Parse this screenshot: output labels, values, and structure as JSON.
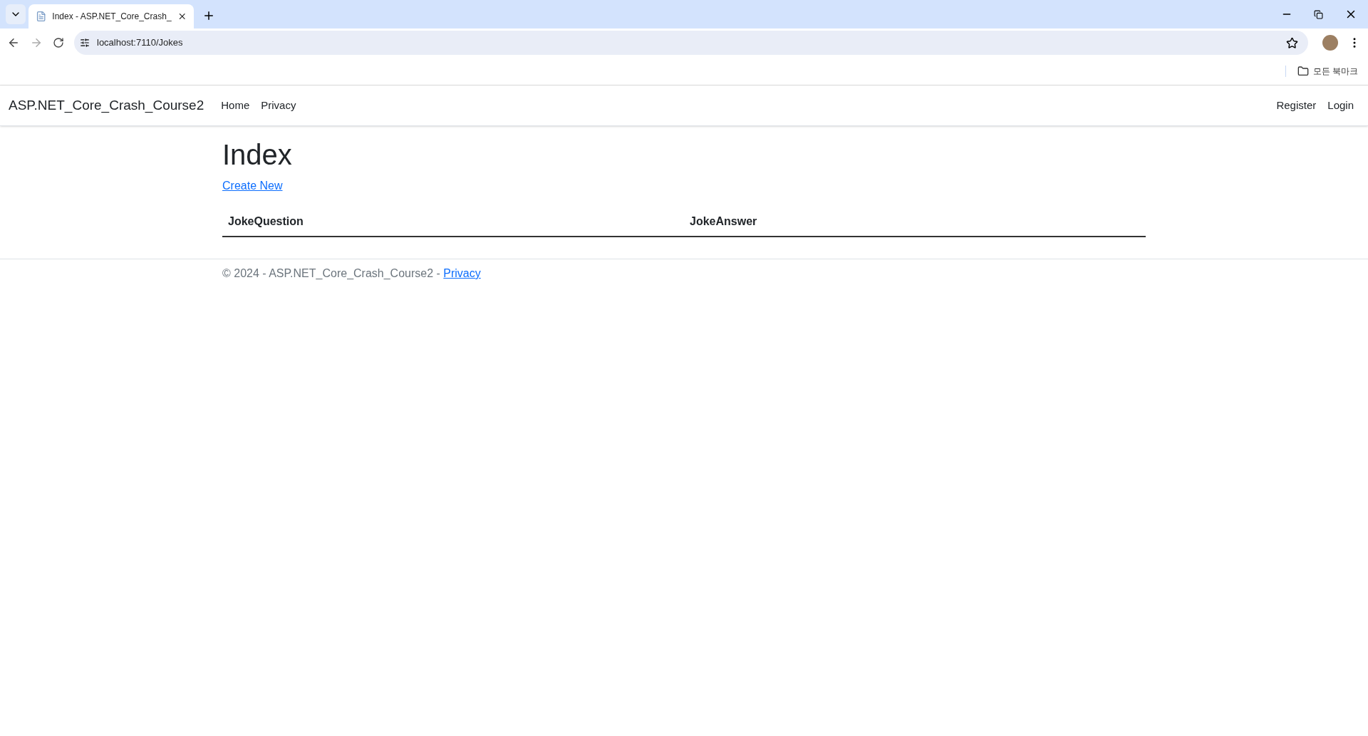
{
  "browser": {
    "tabs": [
      {
        "title": "Index - ASP.NET_Core_Crash_",
        "selected": true
      }
    ],
    "address": "localhost:7110/Jokes",
    "bookmarks_label": "모든 북마크"
  },
  "navbar": {
    "brand": "ASP.NET_Core_Crash_Course2",
    "links": [
      "Home",
      "Privacy"
    ],
    "account_links": [
      "Register",
      "Login"
    ]
  },
  "page": {
    "heading": "Index",
    "create_link": "Create New",
    "table": {
      "columns": [
        "JokeQuestion",
        "JokeAnswer"
      ]
    }
  },
  "footer": {
    "text": "© 2024 - ASP.NET_Core_Crash_Course2 - ",
    "link": "Privacy"
  }
}
